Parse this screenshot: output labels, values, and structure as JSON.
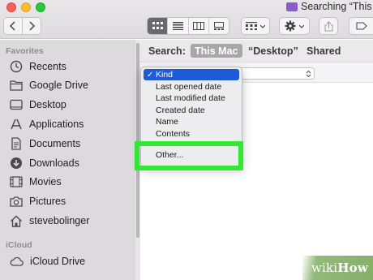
{
  "window": {
    "title": "Searching “This"
  },
  "toolbar": {
    "icons": [
      "back-chevron",
      "forward-chevron",
      "icon-view",
      "list-view",
      "column-view",
      "gallery-view",
      "group-menu",
      "action-gear",
      "share",
      "tag"
    ]
  },
  "sidebar": {
    "favorites_header": "Favorites",
    "items": [
      {
        "label": "Recents",
        "icon": "clock-icon"
      },
      {
        "label": "Google Drive",
        "icon": "folder-icon"
      },
      {
        "label": "Desktop",
        "icon": "desktop-icon"
      },
      {
        "label": "Applications",
        "icon": "applications-icon"
      },
      {
        "label": "Documents",
        "icon": "document-icon"
      },
      {
        "label": "Downloads",
        "icon": "download-icon"
      },
      {
        "label": "Movies",
        "icon": "film-icon"
      },
      {
        "label": "Pictures",
        "icon": "camera-icon"
      },
      {
        "label": "stevebolinger",
        "icon": "home-icon"
      }
    ],
    "icloud_header": "iCloud",
    "icloud_items": [
      {
        "label": "iCloud Drive",
        "icon": "cloud-icon"
      }
    ]
  },
  "search": {
    "label": "Search:",
    "scopes": [
      {
        "label": "This Mac",
        "selected": true
      },
      {
        "label": "“Desktop”",
        "selected": false
      },
      {
        "label": "Shared",
        "selected": false
      }
    ]
  },
  "menu": {
    "items": [
      {
        "label": "Kind",
        "checked": true,
        "highlighted": true
      },
      {
        "label": "Last opened date",
        "checked": false,
        "highlighted": false
      },
      {
        "label": "Last modified date",
        "checked": false,
        "highlighted": false
      },
      {
        "label": "Created date",
        "checked": false,
        "highlighted": false
      },
      {
        "label": "Name",
        "checked": false,
        "highlighted": false
      },
      {
        "label": "Contents",
        "checked": false,
        "highlighted": false
      }
    ],
    "other_label": "Other...",
    "checkmark": "✓"
  },
  "colors": {
    "highlight": "#1e5bd6",
    "callout": "#33e833",
    "sidebar_bg": "#dcdadd"
  },
  "watermark": {
    "brand_a": "wiki",
    "brand_b": "How"
  }
}
